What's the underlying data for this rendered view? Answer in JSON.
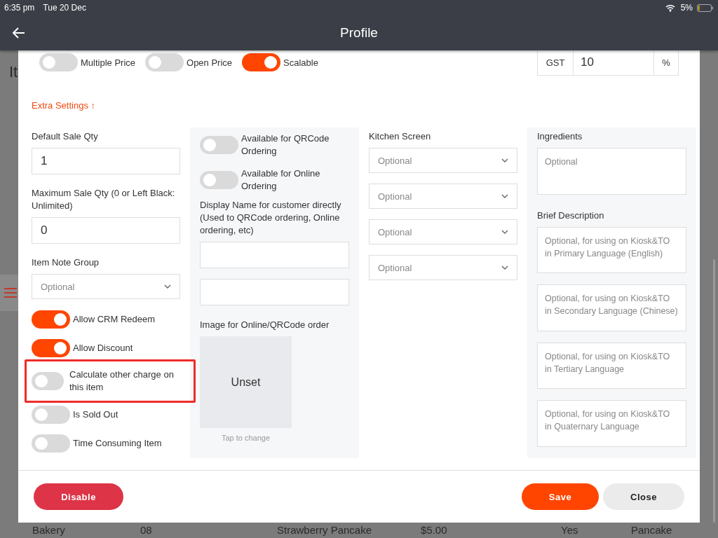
{
  "status_bar": {
    "time": "6:35 pm",
    "date": "Tue 20 Dec",
    "battery": "5%"
  },
  "header": {
    "title": "Profile"
  },
  "background": {
    "heading": "It",
    "row": [
      "Bakery",
      "08",
      "Strawberry Pancake",
      "$5.00",
      "Yes",
      "Pancake"
    ]
  },
  "dialog": {
    "price_toggles": [
      {
        "label": "Multiple Price",
        "on": false
      },
      {
        "label": "Open Price",
        "on": false
      },
      {
        "label": "Scalable",
        "on": true
      }
    ],
    "gst": {
      "label": "GST",
      "value": "10",
      "unit": "%"
    },
    "extra_settings": "Extra Settings ↑",
    "column_1": {
      "fields": [
        {
          "label": "Default Sale Qty",
          "value": "1"
        },
        {
          "label": "Maximum Sale Qty (0 or Left Black: Unlimited)",
          "value": "0"
        }
      ],
      "note_group": {
        "label": "Item Note Group",
        "placeholder": "Optional"
      },
      "toggles": [
        {
          "label": "Allow CRM Redeem",
          "on": true,
          "highlighted": false
        },
        {
          "label": "Allow Discount",
          "on": true,
          "highlighted": false
        },
        {
          "label": "Calculate other charge on this item",
          "on": false,
          "highlighted": true
        },
        {
          "label": "Is Sold Out",
          "on": false,
          "highlighted": false
        },
        {
          "label": "Time Consuming Item",
          "on": false,
          "highlighted": false
        }
      ]
    },
    "column_2": {
      "toggles": [
        {
          "label": "Available for QRCode Ordering",
          "on": false
        },
        {
          "label": "Available for Online Ordering",
          "on": false
        }
      ],
      "display_name": {
        "label": "Display Name for customer directly (Used to QRCode ordering, Online ordering, etc)",
        "fields": [
          {
            "kind": "text"
          },
          {
            "kind": "text"
          }
        ]
      },
      "image": {
        "label": "Image for Online/QRCode order",
        "status": "Unset",
        "hint": "Tap to change"
      }
    },
    "column_3": {
      "label": "Kitchen Screen",
      "selects": [
        {
          "placeholder": "Optional"
        },
        {
          "placeholder": "Optional"
        },
        {
          "placeholder": "Optional"
        },
        {
          "placeholder": "Optional"
        }
      ]
    },
    "column_4": {
      "ingredients": {
        "label": "Ingredients",
        "placeholder": "Optional"
      },
      "brief_description": {
        "label": "Brief Description",
        "fields": [
          {
            "placeholder": "Optional, for using on Kiosk&TO in Primary Language (English)"
          },
          {
            "placeholder": "Optional, for using on Kiosk&TO in Secondary Language (Chinese)"
          },
          {
            "placeholder": "Optional, for using on Kiosk&TO in Tertiary Language"
          },
          {
            "placeholder": "Optional, for using on Kiosk&TO in Quaternary Language"
          }
        ]
      }
    },
    "buttons": [
      {
        "label": "Disable",
        "kind": "danger"
      },
      {
        "label": "Save",
        "kind": "primary"
      },
      {
        "label": "Close",
        "kind": "secondary"
      }
    ]
  }
}
